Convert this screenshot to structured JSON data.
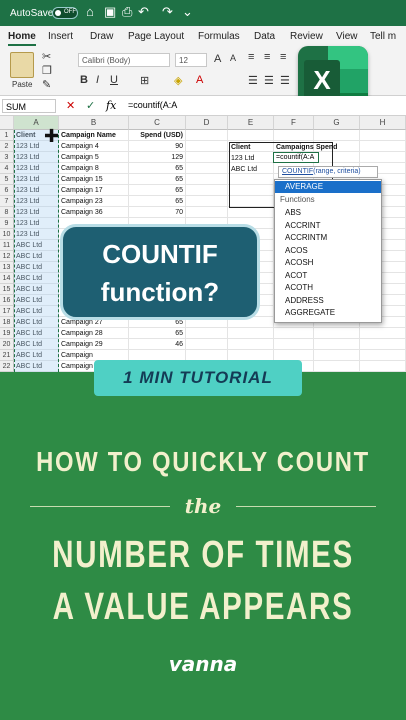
{
  "titlebar": {
    "autosave_label": "AutoSave",
    "toggle_state": "OFF"
  },
  "ribbon": {
    "tabs": [
      "Home",
      "Insert",
      "Draw",
      "Page Layout",
      "Formulas",
      "Data",
      "Review",
      "View",
      "Tell m"
    ],
    "paste_label": "Paste",
    "font_name": "Calibri (Body)",
    "font_size": "12"
  },
  "formula_bar": {
    "name_box": "SUM",
    "fx": "fx",
    "formula": "=countif(A:A"
  },
  "grid": {
    "columns": [
      "A",
      "B",
      "C",
      "D",
      "E",
      "F",
      "G",
      "H"
    ],
    "rows": [
      "1",
      "2",
      "3",
      "4",
      "5",
      "6",
      "7",
      "8",
      "9",
      "10",
      "11",
      "12",
      "13",
      "14",
      "15",
      "16",
      "17",
      "18",
      "19",
      "20",
      "21",
      "22"
    ],
    "headers": {
      "client": "Client",
      "campaign": "Campaign Name",
      "spend": "Spend (USD)"
    },
    "data": [
      [
        "123 Ltd",
        "Campaign 4",
        "90"
      ],
      [
        "123 Ltd",
        "Campaign 5",
        "129"
      ],
      [
        "123 Ltd",
        "Campaign 8",
        "65"
      ],
      [
        "123 Ltd",
        "Campaign 15",
        "65"
      ],
      [
        "123 Ltd",
        "Campaign 17",
        "65"
      ],
      [
        "123 Ltd",
        "Campaign 23",
        "65"
      ],
      [
        "123 Ltd",
        "Campaign 36",
        "70"
      ],
      [
        "123 Ltd",
        "",
        ""
      ],
      [
        "123 Ltd",
        "",
        ""
      ],
      [
        "ABC Ltd",
        "",
        ""
      ],
      [
        "ABC Ltd",
        "",
        ""
      ],
      [
        "ABC Ltd",
        "",
        ""
      ],
      [
        "ABC Ltd",
        "",
        ""
      ],
      [
        "ABC Ltd",
        "",
        ""
      ],
      [
        "ABC Ltd",
        "",
        ""
      ],
      [
        "ABC Ltd",
        "",
        ""
      ],
      [
        "ABC Ltd",
        "Campaign 27",
        "65"
      ],
      [
        "ABC Ltd",
        "Campaign 28",
        "65"
      ],
      [
        "ABC Ltd",
        "Campaign 29",
        "46"
      ],
      [
        "ABC Ltd",
        "Campaign",
        ""
      ],
      [
        "ABC Ltd",
        "Campaign",
        ""
      ]
    ],
    "summary": {
      "client_hdr": "Client",
      "campaigns_hdr": "Campaigns",
      "spend_hdr": "Spend",
      "row1": "123 Ltd",
      "row2": "ABC Ltd",
      "active_formula": "=countif(A:A"
    }
  },
  "autocomplete": {
    "tooltip_fn": "COUNTIF",
    "tooltip_args": "(range, criteria)",
    "selected": "AVERAGE",
    "section": "Functions",
    "items": [
      "ABS",
      "ACCRINT",
      "ACCRINTM",
      "ACOS",
      "ACOSH",
      "ACOT",
      "ACOTH",
      "ADDRESS",
      "AGGREGATE"
    ]
  },
  "overlay": {
    "bubble_line1": "COUNTIF",
    "bubble_line2": "function?",
    "tutorial": "1 MIN TUTORIAL",
    "headline1": "HOW TO QUICKLY COUNT",
    "the": "the",
    "headline2": "NUMBER OF TIMES",
    "headline3": "A VALUE APPEARS",
    "brand": "vanna"
  },
  "colors": {
    "excel_green": "#1e7145",
    "bg_green": "#2e8b45",
    "bubble": "#1e5f72",
    "tutorial": "#4fd0c4"
  }
}
